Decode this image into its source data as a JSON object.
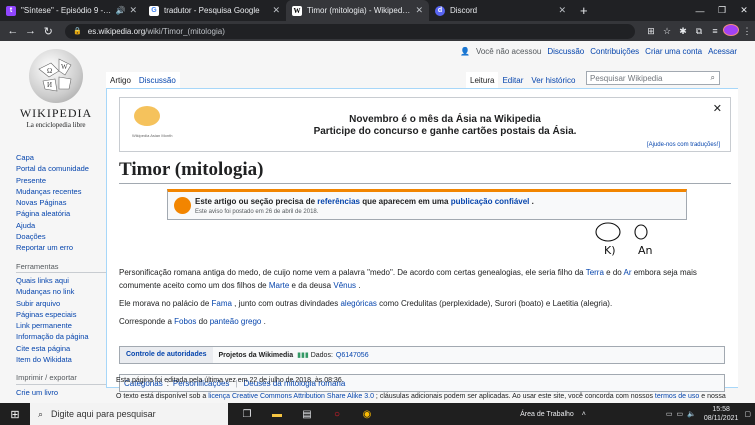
{
  "browser": {
    "tabs": [
      {
        "title": "\"Síntese\" - Episódio 9 - Ordem",
        "icon": "twitch-icon",
        "color": "#9146ff",
        "glyph": "t"
      },
      {
        "title": "tradutor - Pesquisa Google",
        "icon": "google-icon",
        "color": "#ffffff",
        "glyph": "G"
      },
      {
        "title": "Timor (mitologia) - Wikipedia, a e",
        "icon": "wikipedia-icon",
        "color": "#ffffff",
        "glyph": "W"
      },
      {
        "title": "Discord",
        "icon": "discord-icon",
        "color": "#5865f2",
        "glyph": "d"
      }
    ],
    "url_host": "es.wikipedia.org",
    "url_path": "/wiki/Timor_(mitologia)"
  },
  "wiki": {
    "wordmark": "Wikipedia",
    "tagline": "La enciclopedia libre",
    "usertools": [
      "Você não acessou",
      "Discussão",
      "Contribuições",
      "Criar uma conta",
      "Acessar"
    ],
    "tabs_left": [
      "Artigo",
      "Discussão"
    ],
    "tabs_right": [
      "Leitura",
      "Editar",
      "Ver histórico"
    ],
    "search_placeholder": "Pesquisar Wikipedia",
    "sidebar_main": [
      "Capa",
      "Portal da comunidade",
      "Presente",
      "Mudanças recentes",
      "Novas Páginas",
      "Página aleatória",
      "Ajuda",
      "Doações",
      "Reportar um erro"
    ],
    "tools_heading": "Ferramentas",
    "sidebar_tools": [
      "Quais links aqui",
      "Mudanças no link",
      "Subir arquivo",
      "Páginas especiais",
      "Link permanente",
      "Informação da página",
      "Cite esta página",
      "Item do Wikidata"
    ],
    "print_heading": "Imprimir / exportar",
    "sidebar_print": [
      "Crie um livro"
    ],
    "banner": {
      "line1": "Novembro é o mês da Ásia na Wikipedia",
      "line2": "Participe do concurso e ganhe cartões postais da Ásia.",
      "help": "[Ajude-nos com traduções!]",
      "caption": "Wikipedia Asian Month"
    },
    "title": "Timor (mitologia)",
    "ambox": {
      "pre": "Este artigo ou seção precisa de ",
      "link1": "referências",
      "mid": " que aparecem em uma ",
      "link2": "publicação confiável",
      "post": " .",
      "date": "Este aviso foi postado em 26 de abril de 2018."
    },
    "p1": {
      "a": "Personificação romana antiga do medo, de cuijo nome vem a palavra \"medo\". De acordo com certas genealogias, ele seria filho da ",
      "terra": "Terra",
      "b": " e do ",
      "ar": "Ar",
      "c": " embora seja mais comumente aceito como um dos filhos de ",
      "marte": "Marte",
      "d": " e da deusa ",
      "venus": "Vênus",
      "e": " ."
    },
    "p2": {
      "a": "Ele morava no palácio de ",
      "fama": "Fama",
      "b": " , junto com outras divindades ",
      "aleg": "alegóricas",
      "c": " como Credulitas (perplexidade), Surori (boato) e Laetitia (alegria)."
    },
    "p3": {
      "a": "Corresponde a ",
      "fobos": "Fobos",
      "b": " do ",
      "panteao": "panteão grego",
      "c": " ."
    },
    "authority": {
      "label": "Controle de autoridades",
      "projects": "Projetos da Wikimedia",
      "data": "Dados:",
      "qid": "Q6147056"
    },
    "categories": {
      "label": "Categorias",
      "items": [
        "Personificações",
        "Deuses da mitologia romana"
      ]
    },
    "footer1": "Esta página foi editada pela última vez em 22 de julho de 2018, às 08:36.",
    "footer2a": "O texto está disponível sob a ",
    "footer2link": "licença Creative Commons Attribution Share Alike 3.0",
    "footer2b": " ; cláusulas adicionais podem ser aplicadas. Ao usar este site, você concorda com nossos ",
    "footer2link2": "termos de uso",
    "footer2c": " e nossa",
    "ink_notes": [
      "K)",
      "An"
    ]
  },
  "taskbar": {
    "search_placeholder": "Digite aqui para pesquisar",
    "desktop_label": "Área de Trabalho",
    "time": "15:58",
    "date": "08/11/2021"
  }
}
